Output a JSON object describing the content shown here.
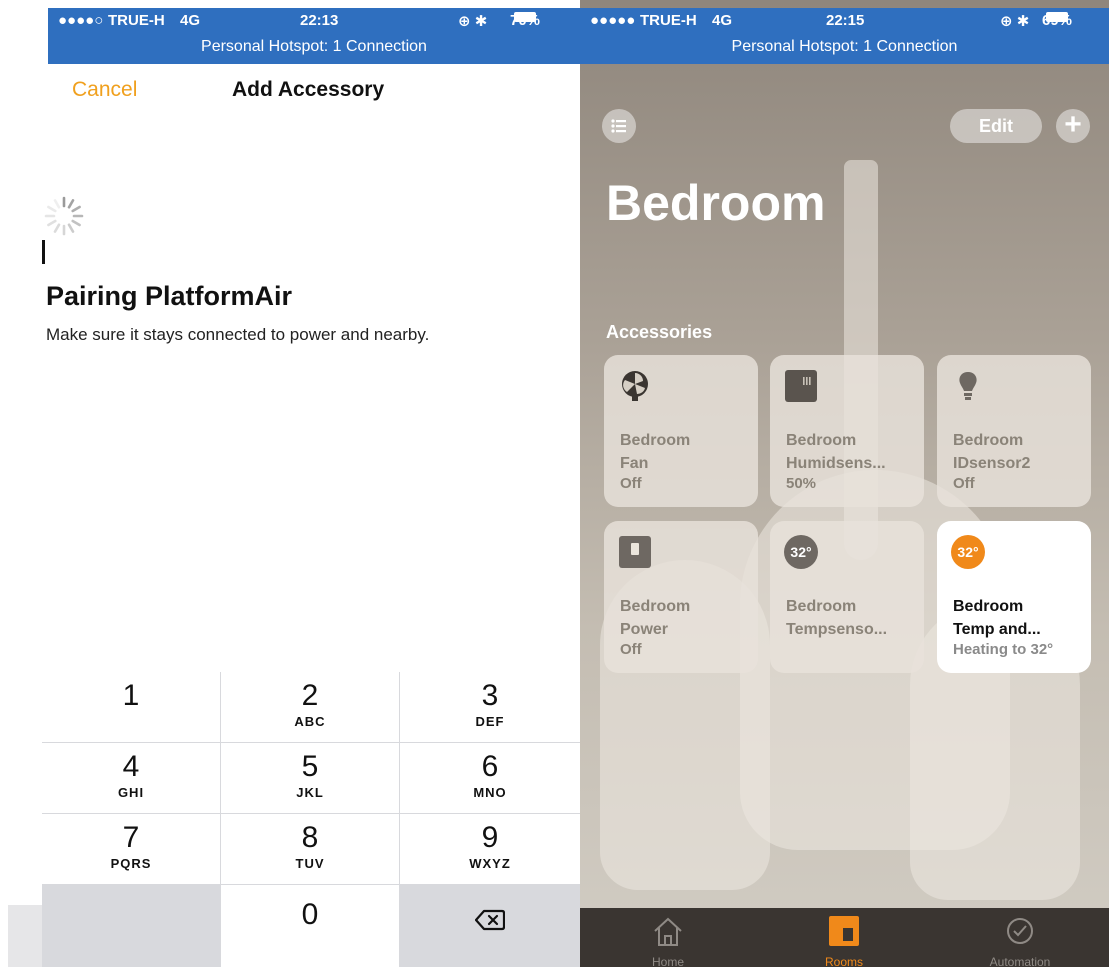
{
  "left_phone": {
    "status": {
      "carrier": "TRUE-H",
      "network": "4G",
      "time": "22:13",
      "battery": "70%",
      "hotspot": "Personal Hotspot: 1 Connection"
    },
    "nav": {
      "cancel": "Cancel",
      "title": "Add Accessory"
    },
    "pairing": {
      "title": "Pairing PlatformAir",
      "subtitle": "Make sure it stays connected to power and nearby."
    },
    "keypad": {
      "keys": [
        {
          "num": "1",
          "letters": ""
        },
        {
          "num": "2",
          "letters": "ABC"
        },
        {
          "num": "3",
          "letters": "DEF"
        },
        {
          "num": "4",
          "letters": "GHI"
        },
        {
          "num": "5",
          "letters": "JKL"
        },
        {
          "num": "6",
          "letters": "MNO"
        },
        {
          "num": "7",
          "letters": "PQRS"
        },
        {
          "num": "8",
          "letters": "TUV"
        },
        {
          "num": "9",
          "letters": "WXYZ"
        },
        {
          "num": "0",
          "letters": ""
        }
      ],
      "delete_icon": "delete-backspace-icon"
    }
  },
  "right_phone": {
    "status": {
      "carrier": "TRUE-H",
      "network": "4G",
      "time": "22:15",
      "battery": "69%",
      "hotspot": "Personal Hotspot: 1 Connection"
    },
    "toolbar": {
      "edit": "Edit",
      "add": "+"
    },
    "room_title": "Bedroom",
    "section": "Accessories",
    "tiles": [
      {
        "line1": "Bedroom",
        "line2": "Fan",
        "state": "Off",
        "icon": "fan-icon",
        "active": false
      },
      {
        "line1": "Bedroom",
        "line2": "Humidsens...",
        "state": "50%",
        "icon": "humidity-sensor-icon",
        "active": false
      },
      {
        "line1": "Bedroom",
        "line2": "IDsensor2",
        "state": "Off",
        "icon": "lightbulb-icon",
        "active": false
      },
      {
        "line1": "Bedroom",
        "line2": "Power",
        "state": "Off",
        "icon": "power-switch-icon",
        "active": false
      },
      {
        "line1": "Bedroom",
        "line2": "Tempsenso...",
        "state": "",
        "icon": "temperature-sensor-icon",
        "badge": "32°",
        "active": false
      },
      {
        "line1": "Bedroom",
        "line2": "Temp and...",
        "state": "Heating to 32°",
        "icon": "thermostat-icon",
        "badge": "32°",
        "active": true
      }
    ],
    "tabs": [
      {
        "label": "Home",
        "icon": "home-icon",
        "active": false
      },
      {
        "label": "Rooms",
        "icon": "rooms-icon",
        "active": true
      },
      {
        "label": "Automation",
        "icon": "automation-clock-icon",
        "active": false
      }
    ],
    "colors": {
      "accent": "#f0891a",
      "hotspot_bar": "#2f6fbf",
      "cancel": "#f0a01e"
    }
  }
}
